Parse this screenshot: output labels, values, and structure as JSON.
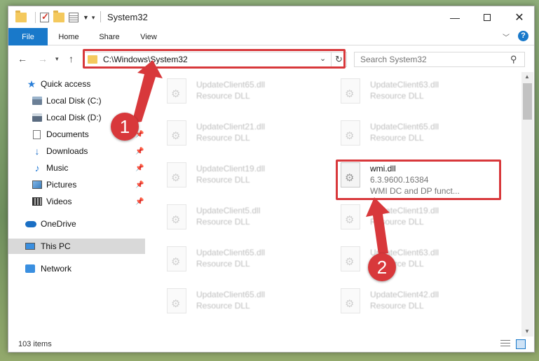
{
  "window": {
    "title": "System32"
  },
  "ribbon": {
    "tabs": [
      "File",
      "Home",
      "Share",
      "View"
    ],
    "help": "?"
  },
  "address_bar": {
    "path": "C:\\Windows\\System32",
    "search_placeholder": "Search System32"
  },
  "sidebar": {
    "items": [
      {
        "label": "Quick access",
        "icon": "star-icon",
        "pinned": false
      },
      {
        "label": "Local Disk (C:)",
        "icon": "disk-icon",
        "pinned": false
      },
      {
        "label": "Local Disk (D:)",
        "icon": "disk-icon",
        "pinned": false
      },
      {
        "label": "Documents",
        "icon": "document-icon",
        "pinned": true
      },
      {
        "label": "Downloads",
        "icon": "download-icon",
        "pinned": true
      },
      {
        "label": "Music",
        "icon": "music-icon",
        "pinned": true
      },
      {
        "label": "Pictures",
        "icon": "pictures-icon",
        "pinned": true
      },
      {
        "label": "Videos",
        "icon": "videos-icon",
        "pinned": true
      },
      {
        "label": "OneDrive",
        "icon": "cloud-icon",
        "pinned": false
      },
      {
        "label": "This PC",
        "icon": "computer-icon",
        "pinned": false,
        "selected": true
      },
      {
        "label": "Network",
        "icon": "network-icon",
        "pinned": false
      }
    ]
  },
  "files": {
    "left": [
      {
        "name": "UpdateClient65.dll",
        "type": "Resource DLL"
      },
      {
        "name": "UpdateClient21.dll",
        "type": "Resource DLL"
      },
      {
        "name": "UpdateClient19.dll",
        "type": "Resource DLL"
      },
      {
        "name": "UpdateClient5.dll",
        "type": "Resource DLL"
      },
      {
        "name": "UpdateClient65.dll",
        "type": "Resource DLL"
      },
      {
        "name": "UpdateClient65.dll",
        "type": "Resource DLL"
      }
    ],
    "right": [
      {
        "name": "UpdateClient63.dll",
        "type": "Resource DLL"
      },
      {
        "name": "UpdateClient65.dll",
        "type": "Resource DLL"
      },
      {
        "name": "UpdateClient19.dll",
        "type": "Resource DLL"
      },
      {
        "name": "UpdateClient63.dll",
        "type": "Resource DLL"
      },
      {
        "name": "UpdateClient42.dll",
        "type": "Resource DLL"
      }
    ],
    "highlighted": {
      "name": "wmi.dll",
      "version": "6.3.9600.16384",
      "description": "WMI DC and DP funct..."
    }
  },
  "status": {
    "item_count": "103 items"
  },
  "annotations": {
    "step1": "1",
    "step2": "2",
    "color": "#d8383b"
  }
}
